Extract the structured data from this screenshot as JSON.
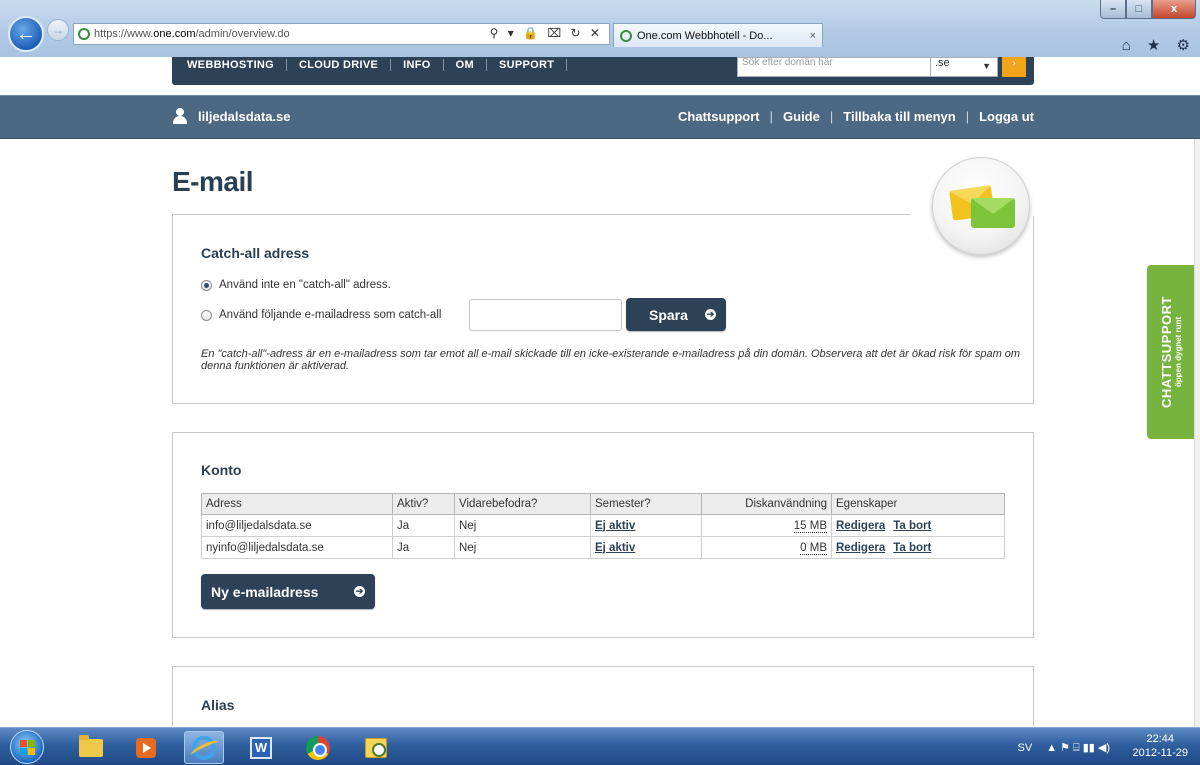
{
  "browser": {
    "url_prefix": "https://www.",
    "url_domain": "one.com",
    "url_path": "/admin/overview.do",
    "address_tools": "⚲ ▾ 🔒 ⌧ ↻ ✕",
    "tab_title": "One.com Webbhotell - Do...",
    "tab_close": "×",
    "right_icons": "⌂ ★ ⚙",
    "window_buttons": [
      "–",
      "□",
      "x"
    ]
  },
  "topnav": {
    "items": [
      "WEBBHOSTING",
      "CLOUD DRIVE",
      "INFO",
      "OM",
      "SUPPORT"
    ],
    "search_placeholder": "Sök efter domän här",
    "tld": ".se",
    "go": "›"
  },
  "userbar": {
    "domain": "liljedalsdata.se",
    "links": [
      "Chattsupport",
      "Guide",
      "Tillbaka till menyn",
      "Logga ut"
    ],
    "separator": "|"
  },
  "page": {
    "title": "E-mail",
    "badge_icon": "mail-envelopes-icon"
  },
  "catchall": {
    "heading": "Catch-all adress",
    "option_none": "Använd inte en \"catch-all\" adress.",
    "option_use": "Använd följande e-mailadress som catch-all",
    "input_value": "",
    "save_label": "Spara",
    "selected": "none",
    "description": "En \"catch-all\"-adress är en e-mailadress som tar emot all e-mail skickade till en icke-existerande e-mailadress på din domän. Observera att det är ökad risk för spam om denna funktionen är aktiverad."
  },
  "accounts": {
    "heading": "Konto",
    "columns": [
      "Adress",
      "Aktiv?",
      "Vidarebefodra?",
      "Semester?",
      "Diskanvändning",
      "Egenskaper"
    ],
    "rows": [
      {
        "address": "info@liljedalsdata.se",
        "active": "Ja",
        "forward": "Nej",
        "vacation": "Ej aktiv",
        "usage": "15 MB",
        "edit": "Redigera",
        "delete": "Ta bort"
      },
      {
        "address": "nyinfo@liljedalsdata.se",
        "active": "Ja",
        "forward": "Nej",
        "vacation": "Ej aktiv",
        "usage": "0 MB",
        "edit": "Redigera",
        "delete": "Ta bort"
      }
    ],
    "new_label": "Ny e-mailadress"
  },
  "alias": {
    "heading": "Alias"
  },
  "chat_tab": {
    "title": "CHATTSUPPORT",
    "subtitle": "öppen dygnet runt"
  },
  "taskbar": {
    "language": "SV",
    "tray_icons": "▲  ⚑  ⌸  ▮▮  ◀)",
    "time": "22:44",
    "date": "2012-11-29"
  },
  "colors": {
    "header_dark": "#2d4256",
    "userbar": "#4c6882",
    "chat_green": "#77b43f",
    "button": "#2d4256"
  }
}
